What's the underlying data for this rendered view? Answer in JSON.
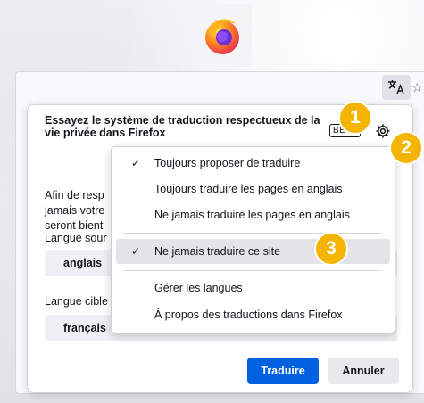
{
  "panel": {
    "title": "Essayez le système de traduction respectueux de la vie privée dans Firefox",
    "beta": "BETA",
    "intro_lines": [
      "Afin de resp",
      "jamais votre",
      "seront bient"
    ],
    "source_label": "Langue sour",
    "source_value": "anglais",
    "target_label": "Langue cible",
    "target_value": "français",
    "translate_label": "Traduire",
    "cancel_label": "Annuler"
  },
  "menu": {
    "items": [
      {
        "label": "Toujours proposer de traduire",
        "checked": true
      },
      {
        "label": "Toujours traduire les pages en anglais",
        "checked": false
      },
      {
        "label": "Ne jamais traduire les pages en anglais",
        "checked": false
      },
      {
        "label": "Ne jamais traduire ce site",
        "checked": true,
        "highlighted": true
      },
      {
        "label": "Gérer les langues",
        "checked": false
      },
      {
        "label": "À propos des traductions dans Firefox",
        "checked": false
      }
    ],
    "check_glyph": "✓"
  },
  "callouts": [
    "1",
    "2",
    "3"
  ],
  "icons": {
    "logo": "firefox-logo",
    "translate": "translate-icon",
    "bookmark": "star-icon",
    "settings": "gear-icon"
  },
  "colors": {
    "primary": "#0061e0",
    "callout": "#f4b400",
    "highlight": "#e3e3e8"
  }
}
